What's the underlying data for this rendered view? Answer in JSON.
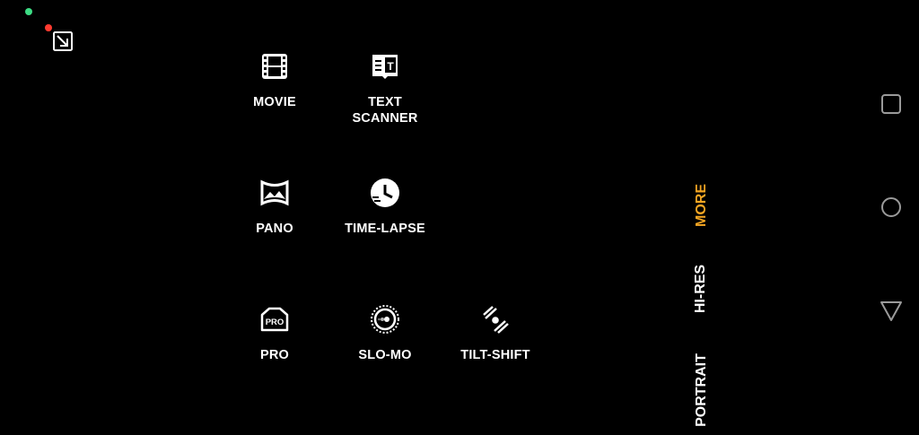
{
  "modes": [
    {
      "id": "movie",
      "icon": "film-icon",
      "label": "MOVIE"
    },
    {
      "id": "text-scanner",
      "icon": "text-scanner-icon",
      "label": "TEXT\nSCANNER"
    },
    {
      "id": "pano",
      "icon": "panorama-icon",
      "label": "PANO"
    },
    {
      "id": "time-lapse",
      "icon": "time-lapse-icon",
      "label": "TIME-LAPSE"
    },
    {
      "id": "pro",
      "icon": "pro-camera-icon",
      "label": "PRO"
    },
    {
      "id": "slo-mo",
      "icon": "slow-motion-icon",
      "label": "SLO-MO"
    },
    {
      "id": "tilt-shift",
      "icon": "tilt-shift-icon",
      "label": "TILT-SHIFT"
    }
  ],
  "mode_tabs": {
    "more": "MORE",
    "hi_res": "HI-RES",
    "portrait": "PORTRAIT"
  },
  "nav_icons": [
    "recents-square-icon",
    "home-circle-icon",
    "back-triangle-icon"
  ],
  "colors": {
    "active_tab": "#f5a623",
    "background": "#000000",
    "text": "#ffffff"
  }
}
